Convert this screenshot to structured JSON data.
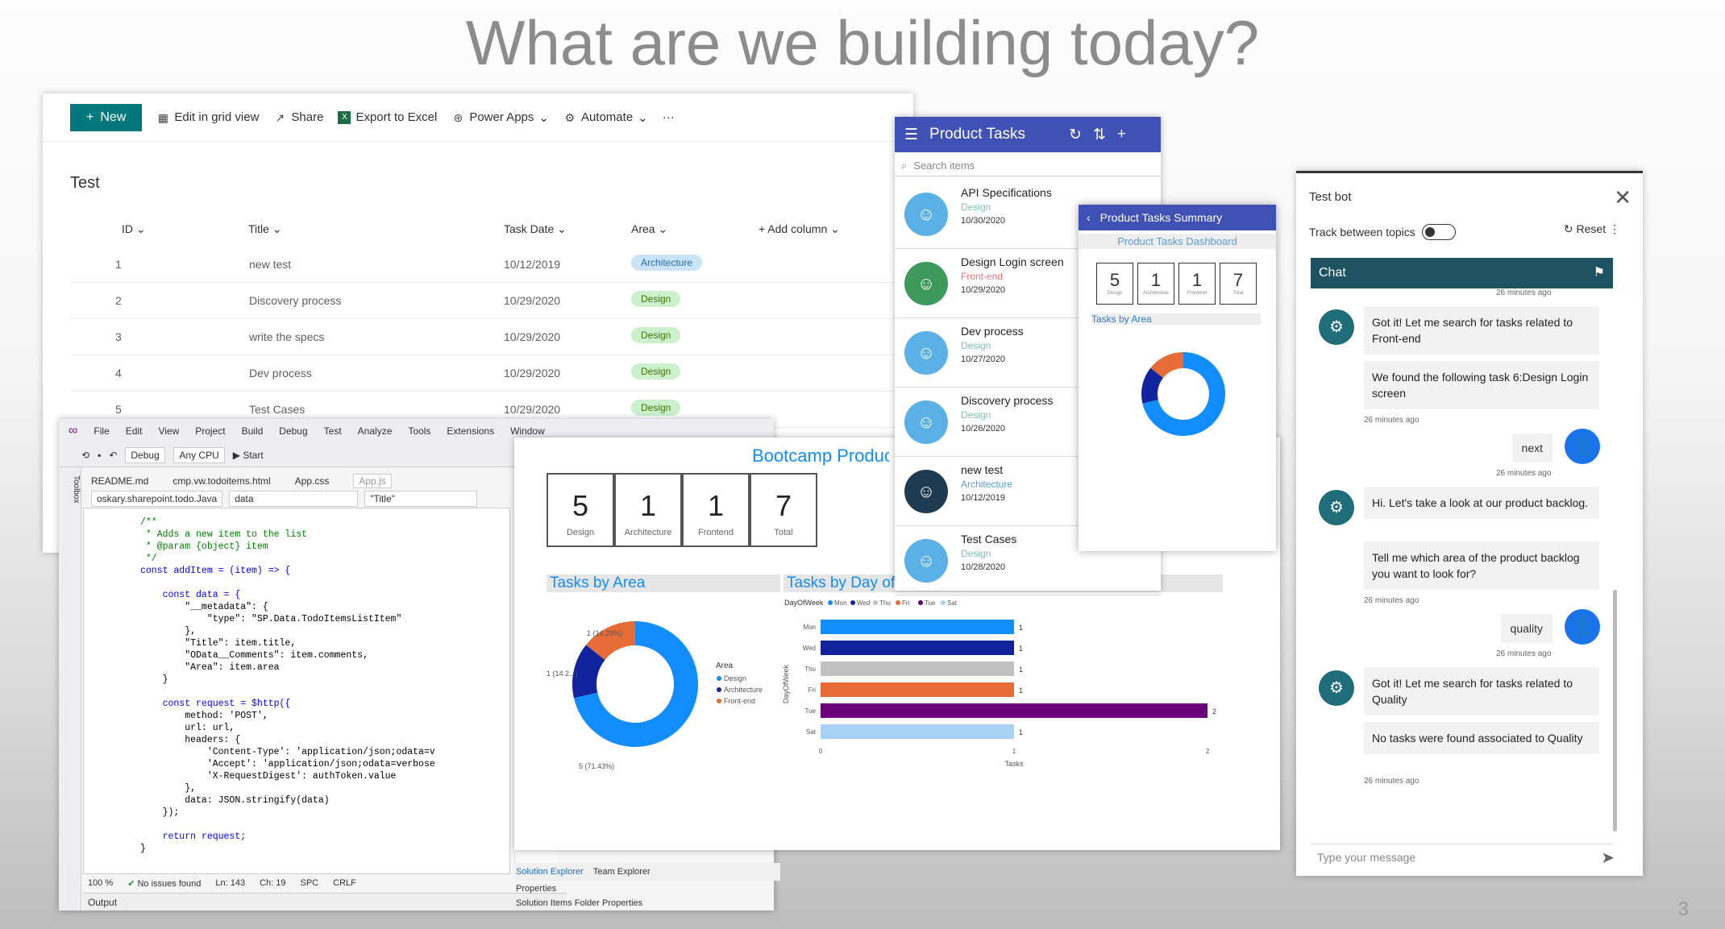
{
  "slide": {
    "title": "What are we building today?",
    "page_number": "3"
  },
  "sharepoint": {
    "commands": {
      "new": "New",
      "edit": "Edit in grid view",
      "share": "Share",
      "export": "Export to Excel",
      "powerapps": "Power Apps",
      "automate": "Automate",
      "more": "···"
    },
    "list_name": "Test",
    "columns": {
      "id": "ID",
      "title": "Title",
      "task_date": "Task Date",
      "area": "Area",
      "add": "+ Add column"
    },
    "rows": [
      {
        "id": "1",
        "title": "new test",
        "date": "10/12/2019",
        "area": "Architecture"
      },
      {
        "id": "2",
        "title": "Discovery process",
        "date": "10/29/2020",
        "area": "Design"
      },
      {
        "id": "3",
        "title": "write the specs",
        "date": "10/29/2020",
        "area": "Design"
      },
      {
        "id": "4",
        "title": "Dev process",
        "date": "10/29/2020",
        "area": "Design"
      },
      {
        "id": "5",
        "title": "Test Cases",
        "date": "10/29/2020",
        "area": "Design"
      }
    ]
  },
  "vs": {
    "menu": [
      "File",
      "Edit",
      "View",
      "Project",
      "Build",
      "Debug",
      "Test",
      "Analyze",
      "Tools",
      "Extensions",
      "Window"
    ],
    "config": "Debug",
    "platform": "Any CPU",
    "start": "Start",
    "tabs": [
      "README.md",
      "cmp.vw.todoitems.html",
      "App.css",
      "App.js"
    ],
    "nav": {
      "project": "oskary.sharepoint.todo.Java",
      "member": "data",
      "scope": "\"Title\""
    },
    "code": [
      "/**",
      " * Adds a new item to the list",
      " * @param {object} item",
      " */",
      "const addItem = (item) => {",
      "",
      "    const data = {",
      "        \"__metadata\": {",
      "            \"type\": \"SP.Data.TodoItemsListItem\"",
      "        },",
      "        \"Title\": item.title,",
      "        \"OData__Comments\": item.comments,",
      "        \"Area\": item.area",
      "    }",
      "",
      "    const request = $http({",
      "        method: 'POST',",
      "        url: url,",
      "        headers: {",
      "            'Content-Type': 'application/json;odata=v",
      "            'Accept': 'application/json;odata=verbose",
      "            'X-RequestDigest': authToken.value",
      "        },",
      "        data: JSON.stringify(data)",
      "    });",
      "",
      "    return request;",
      "}"
    ],
    "status": {
      "zoom": "100 %",
      "issues": "No issues found",
      "ln": "Ln: 143",
      "ch": "Ch: 19",
      "spc": "SPC",
      "crlf": "CRLF"
    },
    "output": "Output",
    "sidebar": "Toolbox",
    "solution": {
      "tab1": "Solution Explorer",
      "tab2": "Team Explorer",
      "props": "Properties",
      "props_sub": "Solution Items  Folder Properties"
    }
  },
  "pbi": {
    "title": "Bootcamp Produc",
    "cards": [
      {
        "value": "5",
        "label": "Design"
      },
      {
        "value": "1",
        "label": "Architecture"
      },
      {
        "value": "1",
        "label": "Frontend"
      },
      {
        "value": "7",
        "label": "Total"
      }
    ],
    "tasks_by_area": "Tasks by Area",
    "tasks_by_day": "Tasks by Day of Week",
    "donut_labels": [
      "1 (14.29%)",
      "1 (14.2...)",
      "5 (71.43%)"
    ],
    "legend_title": "Area",
    "legend": [
      "Design",
      "Architecture",
      "Front-end"
    ],
    "day_legend_title": "DayOfWeek",
    "day_legend": [
      "Mon",
      "Wed",
      "Thu",
      "Fri",
      "Tue",
      "Sat"
    ],
    "y_axis": "DayOfWeek",
    "x_axis": "Tasks",
    "x_ticks": [
      "0",
      "1",
      "2"
    ]
  },
  "chart_data": [
    {
      "type": "pie",
      "title": "Tasks by Area",
      "categories": [
        "Design",
        "Architecture",
        "Front-end"
      ],
      "values": [
        5,
        1,
        1
      ],
      "colors": [
        "#118dff",
        "#12239e",
        "#e66c37"
      ],
      "legend": "right"
    },
    {
      "type": "bar",
      "title": "Tasks by Day of Week",
      "categories": [
        "Mon",
        "Wed",
        "Thu",
        "Fri",
        "Tue",
        "Sat"
      ],
      "values": [
        1,
        1,
        1,
        1,
        2,
        1
      ],
      "colors": [
        "#118dff",
        "#12239e",
        "#c0c0c0",
        "#e66c37",
        "#6b007b",
        "#a7d1f5"
      ],
      "xlabel": "Tasks",
      "ylabel": "DayOfWeek",
      "xlim": [
        0,
        2
      ],
      "legend": "top"
    }
  ],
  "powerapps": {
    "title": "Product Tasks",
    "search_placeholder": "Search items",
    "items": [
      {
        "title": "API Specifications",
        "area": "Design",
        "date": "10/30/2020"
      },
      {
        "title": "Design Login screen",
        "area": "Front-end",
        "date": "10/29/2020"
      },
      {
        "title": "Dev process",
        "area": "Design",
        "date": "10/27/2020"
      },
      {
        "title": "Discovery process",
        "area": "Design",
        "date": "10/26/2020"
      },
      {
        "title": "new test",
        "area": "Architecture",
        "date": "10/12/2019"
      },
      {
        "title": "Test Cases",
        "area": "Design",
        "date": "10/28/2020"
      }
    ]
  },
  "summary": {
    "title": "Product Tasks Summary",
    "subtitle": "Product Tasks Dashboard",
    "cards": [
      {
        "value": "5",
        "label": "Design"
      },
      {
        "value": "1",
        "label": "Architecture"
      },
      {
        "value": "1",
        "label": "Frontend"
      },
      {
        "value": "7",
        "label": "Total"
      }
    ],
    "section": "Tasks by Area"
  },
  "bot": {
    "title": "Test bot",
    "track": "Track between topics",
    "reset": "Reset",
    "chat": "Chat",
    "top_time": "26 minutes ago",
    "messages": [
      {
        "from": "bot",
        "text": "Got it! Let me search for tasks related to Front-end"
      },
      {
        "from": "bot",
        "text": "We found the following task 6:Design Login screen",
        "time": "26 minutes ago"
      },
      {
        "from": "user",
        "text": "next",
        "time": "26 minutes ago"
      },
      {
        "from": "bot",
        "text": "Hi. Let's take a look at our product backlog."
      },
      {
        "from": "bot",
        "text": "Tell me which area of the product backlog you want to look for?",
        "time": "26 minutes ago"
      },
      {
        "from": "user",
        "text": "quality",
        "time": "26 minutes ago"
      },
      {
        "from": "bot",
        "text": "Got it! Let me search for tasks related to Quality"
      },
      {
        "from": "bot",
        "text": "No tasks were found associated to Quality",
        "time": "26 minutes ago"
      }
    ],
    "input_placeholder": "Type your message"
  }
}
